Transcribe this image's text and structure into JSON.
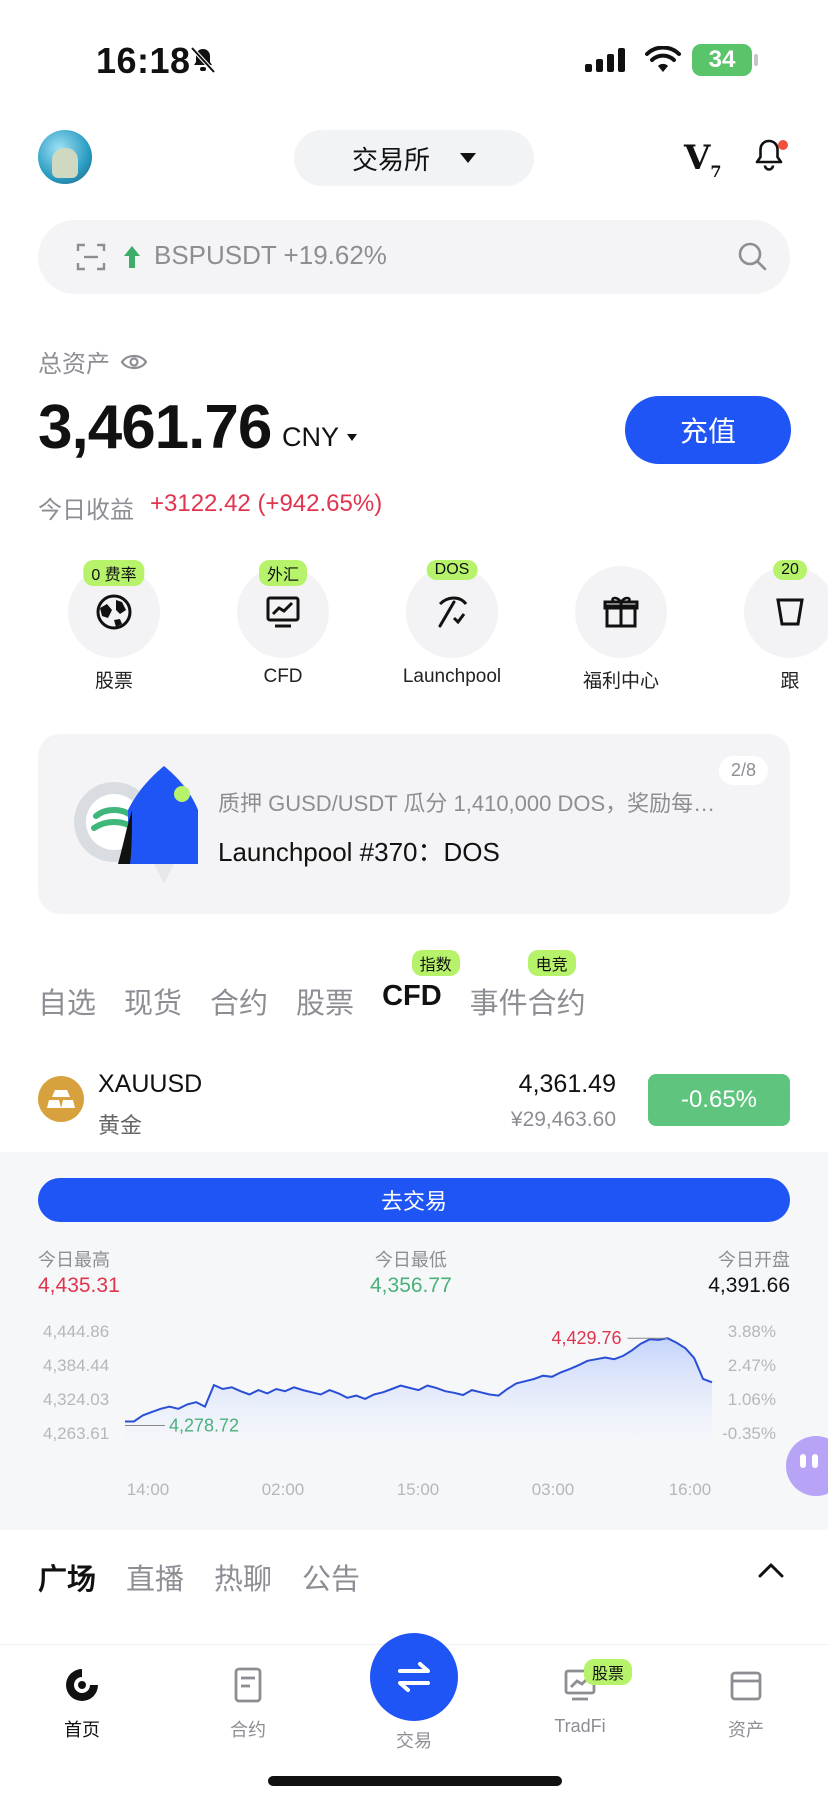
{
  "status_bar": {
    "time": "16:18",
    "battery": "34"
  },
  "header": {
    "exchange_label": "交易所",
    "vip_label": "V",
    "vip_level": "7"
  },
  "search": {
    "trending_text": "BSPUSDT +19.62%"
  },
  "assets": {
    "label": "总资产",
    "value": "3,461.76",
    "currency": "CNY",
    "deposit_label": "充值",
    "today_label": "今日收益",
    "today_value": "+3122.42 (+942.65%)"
  },
  "quick_actions": [
    {
      "label": "股票",
      "badge": "0 费率",
      "icon": "globe-icon"
    },
    {
      "label": "CFD",
      "badge": "外汇",
      "icon": "chart-monitor-icon"
    },
    {
      "label": "Launchpool",
      "badge": "DOS",
      "icon": "pickaxe-icon"
    },
    {
      "label": "福利中心",
      "badge": "",
      "icon": "gift-icon"
    },
    {
      "label": "跟",
      "badge": "20",
      "icon": "copy-trade-icon"
    }
  ],
  "banner": {
    "subtitle": "质押 GUSD/USDT 瓜分 1,410,000 DOS，奖励每…",
    "title": "Launchpool #370：DOS",
    "pager": "2/8"
  },
  "market_tabs": [
    {
      "label": "自选",
      "badge": ""
    },
    {
      "label": "现货",
      "badge": ""
    },
    {
      "label": "合约",
      "badge": ""
    },
    {
      "label": "股票",
      "badge": ""
    },
    {
      "label": "CFD",
      "badge": "指数"
    },
    {
      "label": "事件合约",
      "badge": "电竞"
    }
  ],
  "ticker": {
    "symbol": "XAUUSD",
    "name": "黄金",
    "price": "4,361.49",
    "price_cny": "¥29,463.60",
    "change": "-0.65%"
  },
  "trade_panel": {
    "trade_label": "去交易",
    "high_label": "今日最高",
    "high_value": "4,435.31",
    "low_label": "今日最低",
    "low_value": "4,356.77",
    "open_label": "今日开盘",
    "open_value": "4,391.66"
  },
  "chart_data": {
    "type": "area",
    "x_ticks": [
      "14:00",
      "02:00",
      "15:00",
      "03:00",
      "16:00"
    ],
    "y_ticks_left": [
      "4,444.86",
      "4,384.44",
      "4,324.03",
      "4,263.61"
    ],
    "y_ticks_right": [
      "3.88%",
      "2.47%",
      "1.06%",
      "-0.35%"
    ],
    "annotations": {
      "max_label": "4,429.76",
      "min_label": "4,278.72"
    },
    "ylim": [
      4263.61,
      4444.86
    ],
    "series": [
      {
        "values": [
          4279,
          4279,
          4290,
          4296,
          4302,
          4306,
          4302,
          4310,
          4314,
          4306,
          4345,
          4338,
          4341,
          4334,
          4328,
          4336,
          4330,
          4338,
          4334,
          4341,
          4336,
          4332,
          4328,
          4336,
          4330,
          4322,
          4326,
          4320,
          4328,
          4332,
          4338,
          4344,
          4340,
          4336,
          4344,
          4340,
          4334,
          4331,
          4327,
          4336,
          4332,
          4328,
          4326,
          4338,
          4348,
          4352,
          4356,
          4362,
          4360,
          4368,
          4374,
          4381,
          4389,
          4392,
          4395,
          4392,
          4398,
          4408,
          4420,
          4428,
          4427,
          4430,
          4422,
          4412,
          4394,
          4356,
          4350
        ]
      }
    ]
  },
  "community_tabs": [
    "广场",
    "直播",
    "热聊",
    "公告"
  ],
  "bottom_nav": [
    {
      "label": "首页",
      "icon": "home-icon"
    },
    {
      "label": "合约",
      "icon": "contract-icon"
    },
    {
      "label": "交易",
      "icon": "swap-icon"
    },
    {
      "label": "TradFi",
      "icon": "tradfi-icon",
      "badge": "股票"
    },
    {
      "label": "资产",
      "icon": "wallet-icon"
    }
  ],
  "colors": {
    "accent": "#1f54f5",
    "up": "#e0344f",
    "down": "#4bb07a",
    "badge": "#b6f36a"
  }
}
